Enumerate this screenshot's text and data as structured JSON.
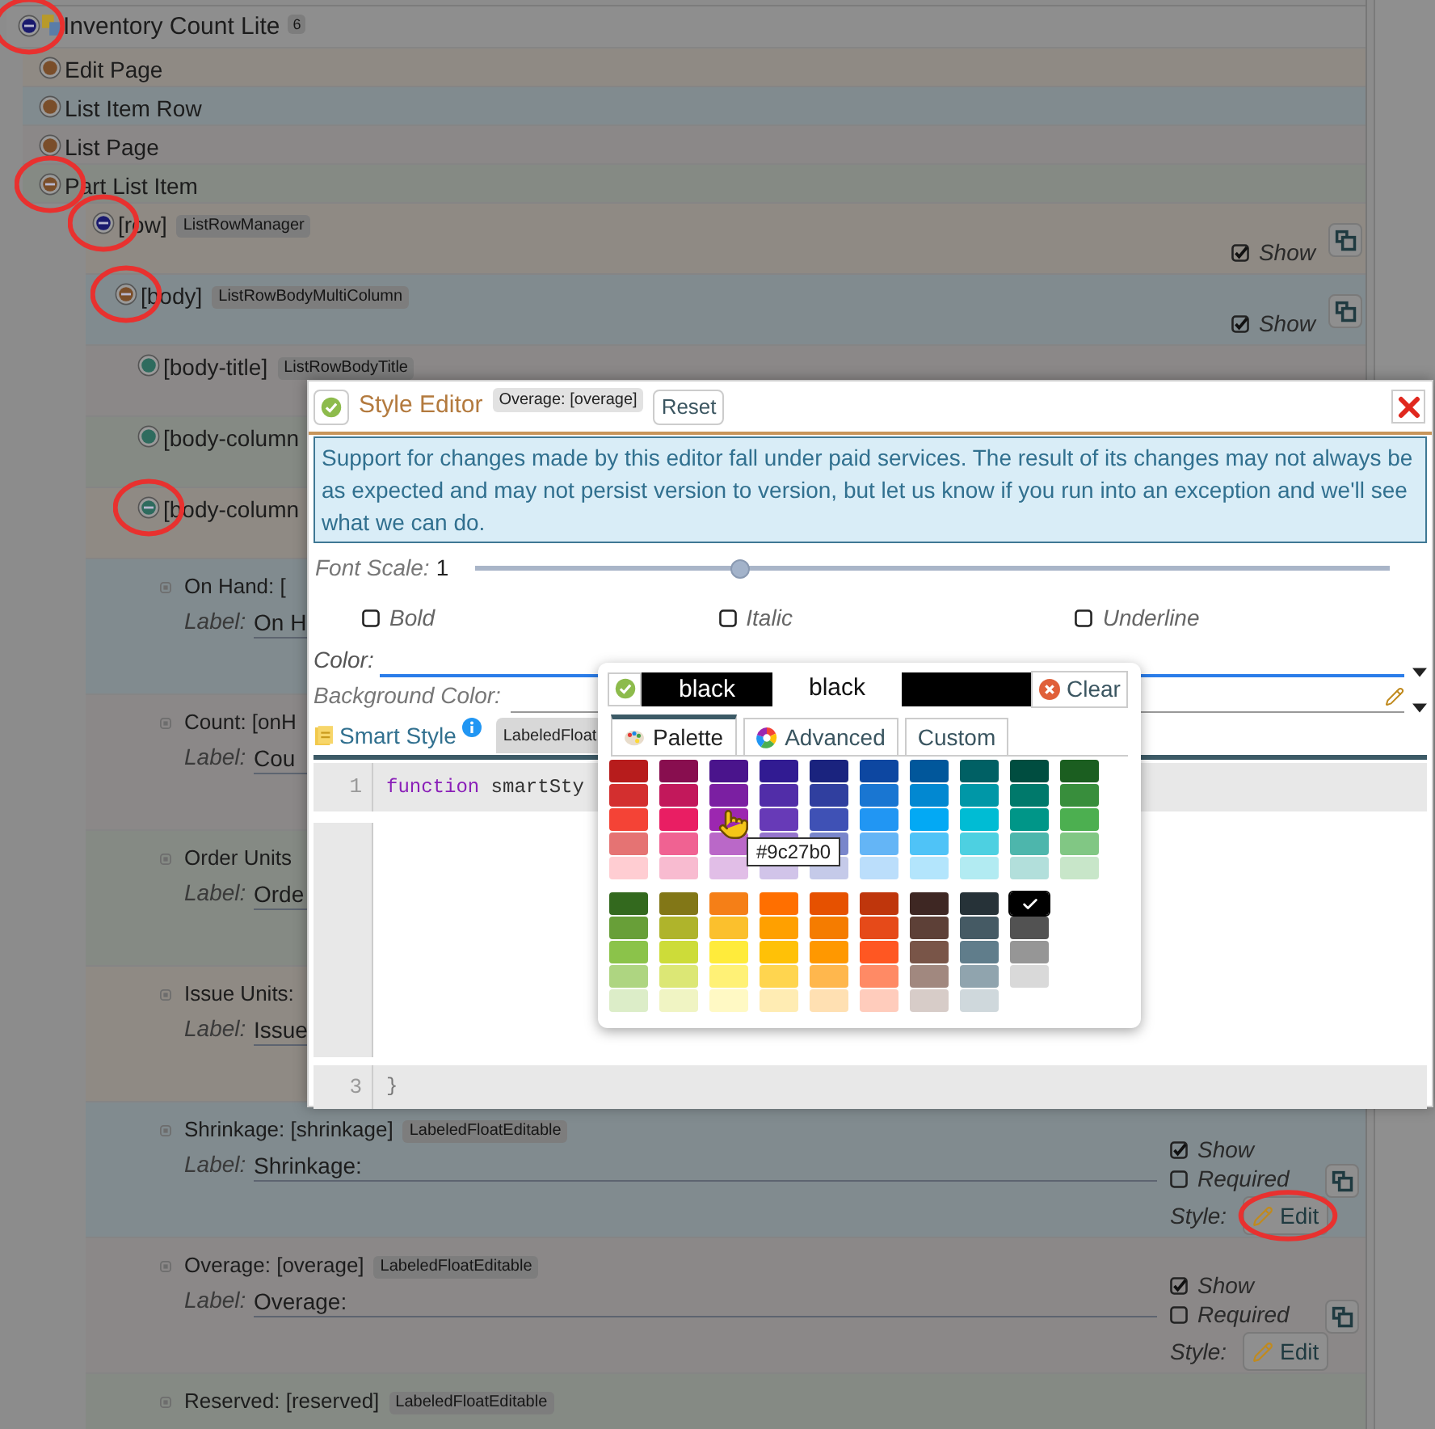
{
  "tree": {
    "kind": "root",
    "label": "Inventory Count Lite",
    "count": "6",
    "expanded": true,
    "circled": true,
    "color": "#1a1a6e",
    "children": [
      {
        "kind": "node",
        "label": "Edit Page",
        "expanded": false,
        "circled": false,
        "color": "#7a4e2a"
      },
      {
        "kind": "node",
        "label": "List Item Row",
        "expanded": false,
        "circled": false,
        "color": "#7a4e2a"
      },
      {
        "kind": "node",
        "label": "List Page",
        "expanded": false,
        "circled": false,
        "color": "#7a4e2a"
      },
      {
        "kind": "node",
        "label": "Part List Item",
        "expanded": true,
        "circled": true,
        "color": "#7a4e2a",
        "children": [
          {
            "kind": "node",
            "label": "[row]",
            "type": "ListRowManager",
            "expanded": true,
            "circled": true,
            "color": "#1a1a6e",
            "copyable": true,
            "options": [
              {
                "label": "Show",
                "checked": true
              }
            ],
            "children": [
              {
                "kind": "node",
                "label": "[body]",
                "type": "ListRowBodyMultiColumn",
                "expanded": true,
                "circled": true,
                "color": "#7a4e2a",
                "copyable": true,
                "options": [
                  {
                    "label": "Show",
                    "checked": true
                  }
                ],
                "children": [
                  {
                    "kind": "node",
                    "label": "[body-title]",
                    "type": "ListRowBodyTitle",
                    "expanded": false,
                    "circled": false,
                    "color": "#2e6b5e"
                  },
                  {
                    "kind": "node",
                    "label": "[body-column",
                    "expanded": false,
                    "circled": false,
                    "color": "#2e6b5e"
                  },
                  {
                    "kind": "node",
                    "label": "[body-column",
                    "expanded": true,
                    "circled": true,
                    "color": "#2e6b5e",
                    "children": [
                      {
                        "kind": "field",
                        "label": "On Hand: [",
                        "field_label": "Label:",
                        "value": "On H"
                      },
                      {
                        "kind": "field",
                        "label": "Count: [onH",
                        "field_label": "Label:",
                        "value": "Cou"
                      },
                      {
                        "kind": "field",
                        "label": "Order Units",
                        "field_label": "Label:",
                        "value": "Orde"
                      },
                      {
                        "kind": "field",
                        "label": "Issue Units:",
                        "field_label": "Label:",
                        "value": "Issue"
                      },
                      {
                        "kind": "field",
                        "label": "Shrinkage: [shrinkage]",
                        "type": "LabeledFloatEditable",
                        "field_label": "Label:",
                        "value": "Shrinkage:",
                        "copyable": true,
                        "options": [
                          {
                            "label": "Show",
                            "checked": true
                          },
                          {
                            "label": "Required",
                            "checked": false
                          }
                        ],
                        "style_label": "Style:",
                        "style_button": "Edit",
                        "style_circled": true
                      },
                      {
                        "kind": "field",
                        "label": "Overage: [overage]",
                        "type": "LabeledFloatEditable",
                        "field_label": "Label:",
                        "value": "Overage:",
                        "copyable": true,
                        "options": [
                          {
                            "label": "Show",
                            "checked": true
                          },
                          {
                            "label": "Required",
                            "checked": false
                          }
                        ],
                        "style_label": "Style:",
                        "style_button": "Edit",
                        "style_circled": false
                      },
                      {
                        "kind": "field",
                        "label": "Reserved: [reserved]",
                        "type": "LabeledFloatEditable"
                      }
                    ]
                  }
                ]
              }
            ]
          }
        ]
      }
    ]
  },
  "style_editor": {
    "title": "Style Editor",
    "badge": "Overage: [overage]",
    "reset_button": "Reset",
    "notice": "Support for changes made by this editor fall under paid services. The result of its changes may not always be as expected and may not persist version to version, but let us know if you run into an exception and we'll see what we can do.",
    "font_scale": {
      "label": "Font Scale:",
      "value": "1",
      "level": 0.29
    },
    "toggles": [
      {
        "label": "Bold",
        "checked": false
      },
      {
        "label": "Italic",
        "checked": false
      },
      {
        "label": "Underline",
        "checked": false
      }
    ],
    "color": {
      "label": "Color:",
      "focused": true
    },
    "background_color": {
      "label": "Background Color:",
      "focused": false
    },
    "tabs": [
      {
        "label": "Smart Style",
        "selected": true
      },
      {
        "label": "LabeledFloat",
        "selected": false
      }
    ],
    "code": [
      {
        "number": "1",
        "tokens": [
          {
            "kind": "keyword",
            "text": "function"
          },
          {
            "kind": "plain",
            "text": " smartSty"
          }
        ]
      },
      {
        "number": "3",
        "tokens": [
          {
            "kind": "plain",
            "text": "}"
          }
        ]
      }
    ]
  },
  "color_picker": {
    "current": "black",
    "preview": {
      "label": "black",
      "color": "#000000"
    },
    "clear_button": "Clear",
    "tabs": [
      {
        "label": "Palette",
        "kind": "palette",
        "selected": true
      },
      {
        "label": "Advanced",
        "kind": "wheel",
        "selected": false
      },
      {
        "label": "Custom",
        "kind": "none",
        "selected": false
      }
    ],
    "groups": [
      {
        "columns": [
          {
            "swatches": [
              {
                "color": "#b71c1c",
                "selected": false
              },
              {
                "color": "#d32f2f",
                "selected": false
              },
              {
                "color": "#f44336",
                "selected": false
              },
              {
                "color": "#e57373",
                "selected": false
              },
              {
                "color": "#ffcdd2",
                "selected": false
              }
            ]
          },
          {
            "swatches": [
              {
                "color": "#880e4f",
                "selected": false
              },
              {
                "color": "#c2185b",
                "selected": false
              },
              {
                "color": "#e91e63",
                "selected": false
              },
              {
                "color": "#f06292",
                "selected": false
              },
              {
                "color": "#f8bbd0",
                "selected": false
              }
            ]
          },
          {
            "swatches": [
              {
                "color": "#4a148c",
                "selected": false
              },
              {
                "color": "#7b1fa2",
                "selected": false
              },
              {
                "color": "#9c27b0",
                "selected": false
              },
              {
                "color": "#ba68c8",
                "selected": false
              },
              {
                "color": "#e1bee7",
                "selected": false
              }
            ]
          },
          {
            "swatches": [
              {
                "color": "#311b92",
                "selected": false
              },
              {
                "color": "#512da8",
                "selected": false
              },
              {
                "color": "#673ab7",
                "selected": false
              },
              {
                "color": "#9575cd",
                "selected": false
              },
              {
                "color": "#d1c4e9",
                "selected": false
              }
            ]
          },
          {
            "swatches": [
              {
                "color": "#1a237e",
                "selected": false
              },
              {
                "color": "#303f9f",
                "selected": false
              },
              {
                "color": "#3f51b5",
                "selected": false
              },
              {
                "color": "#7986cb",
                "selected": false
              },
              {
                "color": "#c5cae9",
                "selected": false
              }
            ]
          },
          {
            "swatches": [
              {
                "color": "#0d47a1",
                "selected": false
              },
              {
                "color": "#1976d2",
                "selected": false
              },
              {
                "color": "#2196f3",
                "selected": false
              },
              {
                "color": "#64b5f6",
                "selected": false
              },
              {
                "color": "#bbdefb",
                "selected": false
              }
            ]
          },
          {
            "swatches": [
              {
                "color": "#01579b",
                "selected": false
              },
              {
                "color": "#0288d1",
                "selected": false
              },
              {
                "color": "#03a9f4",
                "selected": false
              },
              {
                "color": "#4fc3f7",
                "selected": false
              },
              {
                "color": "#b3e5fc",
                "selected": false
              }
            ]
          },
          {
            "swatches": [
              {
                "color": "#006064",
                "selected": false
              },
              {
                "color": "#0097a7",
                "selected": false
              },
              {
                "color": "#00bcd4",
                "selected": false
              },
              {
                "color": "#4dd0e1",
                "selected": false
              },
              {
                "color": "#b2ebf2",
                "selected": false
              }
            ]
          },
          {
            "swatches": [
              {
                "color": "#004d40",
                "selected": false
              },
              {
                "color": "#00796b",
                "selected": false
              },
              {
                "color": "#009688",
                "selected": false
              },
              {
                "color": "#4db6ac",
                "selected": false
              },
              {
                "color": "#b2dfdb",
                "selected": false
              }
            ]
          },
          {
            "swatches": [
              {
                "color": "#1b5e20",
                "selected": false
              },
              {
                "color": "#388e3c",
                "selected": false
              },
              {
                "color": "#4caf50",
                "selected": false
              },
              {
                "color": "#81c784",
                "selected": false
              },
              {
                "color": "#c8e6c9",
                "selected": false
              }
            ]
          }
        ]
      },
      {
        "columns": [
          {
            "swatches": [
              {
                "color": "#33691e",
                "selected": false
              },
              {
                "color": "#689f38",
                "selected": false
              },
              {
                "color": "#8bc34a",
                "selected": false
              },
              {
                "color": "#aed581",
                "selected": false
              },
              {
                "color": "#dcedc8",
                "selected": false
              }
            ]
          },
          {
            "swatches": [
              {
                "color": "#827717",
                "selected": false
              },
              {
                "color": "#afb42b",
                "selected": false
              },
              {
                "color": "#cddc39",
                "selected": false
              },
              {
                "color": "#dce775",
                "selected": false
              },
              {
                "color": "#f0f4c3",
                "selected": false
              }
            ]
          },
          {
            "swatches": [
              {
                "color": "#f57f17",
                "selected": false
              },
              {
                "color": "#fbc02d",
                "selected": false
              },
              {
                "color": "#ffeb3b",
                "selected": false
              },
              {
                "color": "#fff176",
                "selected": false
              },
              {
                "color": "#fff9c4",
                "selected": false
              }
            ]
          },
          {
            "swatches": [
              {
                "color": "#ff6f00",
                "selected": false
              },
              {
                "color": "#ffa000",
                "selected": false
              },
              {
                "color": "#ffc107",
                "selected": false
              },
              {
                "color": "#ffd54f",
                "selected": false
              },
              {
                "color": "#ffecb3",
                "selected": false
              }
            ]
          },
          {
            "swatches": [
              {
                "color": "#e65100",
                "selected": false
              },
              {
                "color": "#f57c00",
                "selected": false
              },
              {
                "color": "#ff9800",
                "selected": false
              },
              {
                "color": "#ffb74d",
                "selected": false
              },
              {
                "color": "#ffe0b2",
                "selected": false
              }
            ]
          },
          {
            "swatches": [
              {
                "color": "#bf360c",
                "selected": false
              },
              {
                "color": "#e64a19",
                "selected": false
              },
              {
                "color": "#ff5722",
                "selected": false
              },
              {
                "color": "#ff8a65",
                "selected": false
              },
              {
                "color": "#ffccbc",
                "selected": false
              }
            ]
          },
          {
            "swatches": [
              {
                "color": "#3e2723",
                "selected": false
              },
              {
                "color": "#5d4037",
                "selected": false
              },
              {
                "color": "#795548",
                "selected": false
              },
              {
                "color": "#a1887f",
                "selected": false
              },
              {
                "color": "#d7ccc8",
                "selected": false
              }
            ]
          },
          {
            "swatches": [
              {
                "color": "#263238",
                "selected": false
              },
              {
                "color": "#455a64",
                "selected": false
              },
              {
                "color": "#607d8b",
                "selected": false
              },
              {
                "color": "#90a4ae",
                "selected": false
              },
              {
                "color": "#cfd8dc",
                "selected": false
              }
            ]
          },
          {
            "swatches": [
              {
                "color": "#000000",
                "selected": true
              },
              {
                "color": "#525252",
                "selected": false
              },
              {
                "color": "#969696",
                "selected": false
              },
              {
                "color": "#d9d9d9",
                "selected": false
              }
            ]
          }
        ]
      }
    ],
    "tooltip": "#9c27b0"
  }
}
